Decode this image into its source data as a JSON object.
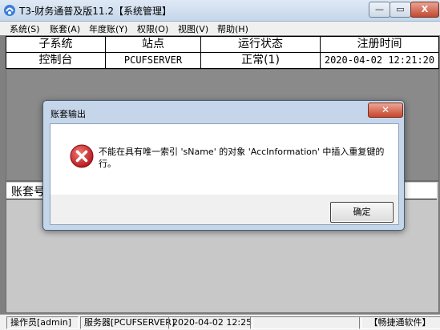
{
  "window": {
    "title": "T3-财务通普及版11.2【系统管理】",
    "min_label": "—",
    "max_label": "▭",
    "close_label": "X"
  },
  "menu": [
    "系统(S)",
    "账套(A)",
    "年度账(Y)",
    "权限(O)",
    "视图(V)",
    "帮助(H)"
  ],
  "grid": {
    "headers": [
      "子系统",
      "站点",
      "运行状态",
      "注册时间"
    ],
    "rows": [
      [
        "控制台",
        "PCUFSERVER",
        "正常(1)",
        "2020-04-02 12:21:20"
      ]
    ]
  },
  "lower_panel": {
    "header_label": "账套号"
  },
  "dialog": {
    "title": "账套输出",
    "close_label": "✕",
    "icon": "error-icon",
    "message": "不能在具有唯一索引 'sName' 的对象 'AccInformation' 中插入重复键的行。",
    "ok_label": "确定"
  },
  "statusbar": {
    "operator": "操作员[admin]",
    "server": "服务器[PCUFSERVER]",
    "time": "2020-04-02 12:25",
    "blank": "",
    "brand": "【畅捷通软件】"
  },
  "colors": {
    "error_red": "#c8202a",
    "dialog_frame": "#c6d6ea",
    "workspace": "#808080"
  }
}
